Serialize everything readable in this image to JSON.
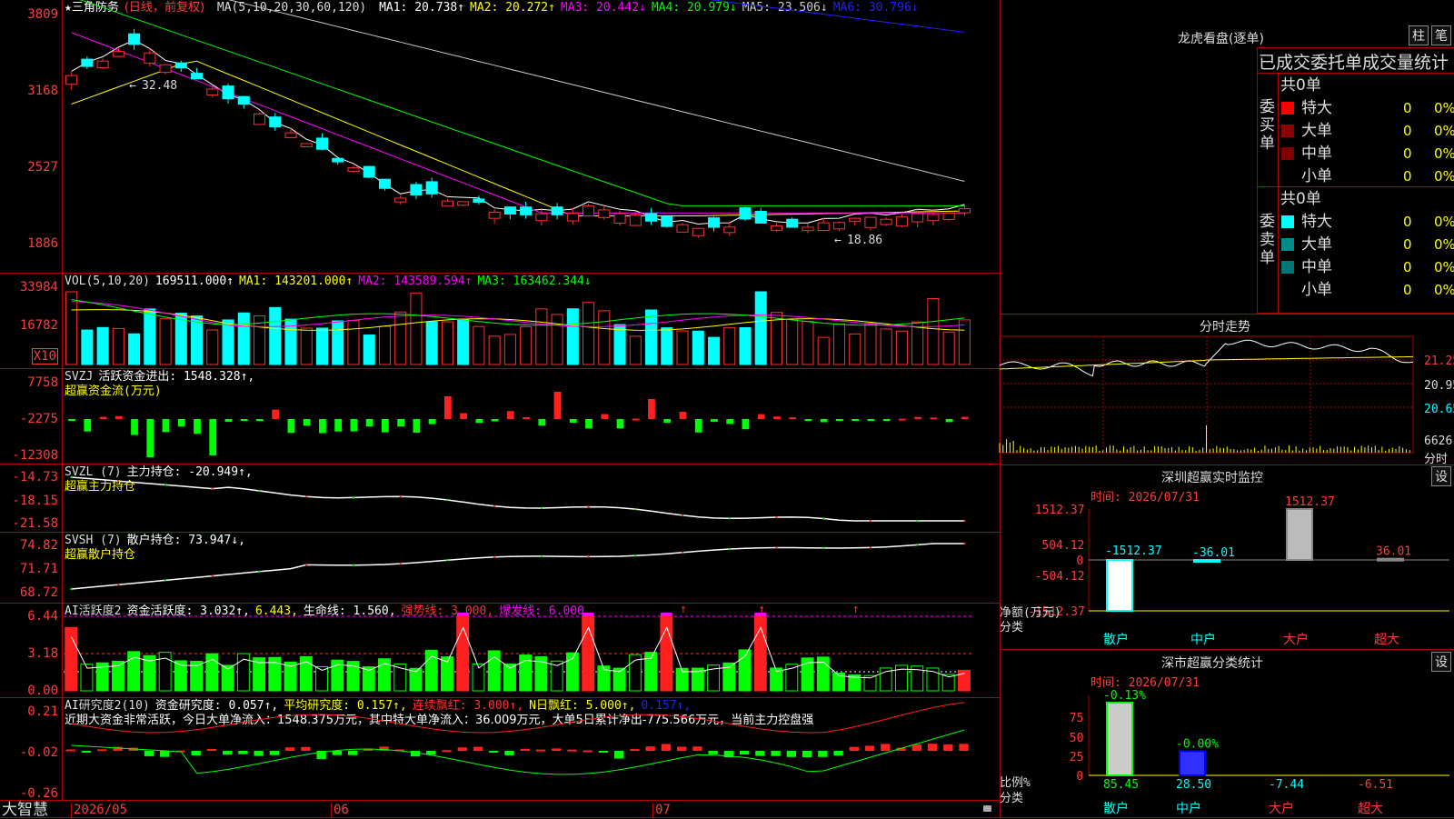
{
  "stock": {
    "name": "三角防务",
    "period": "日线",
    "adjust": "前复权",
    "marker": "★"
  },
  "main": {
    "ma_label": "MA(5,10,20,30,60,120)",
    "ma": [
      {
        "k": "MA1:",
        "v": "20.738↑",
        "color": "#ffffff"
      },
      {
        "k": "MA2:",
        "v": "20.272↑",
        "color": "#ffff00"
      },
      {
        "k": "MA3:",
        "v": "20.442↓",
        "color": "#ff00ff"
      },
      {
        "k": "MA4:",
        "v": "20.979↓",
        "color": "#00ff00"
      },
      {
        "k": "MA5:",
        "v": "23.506↓",
        "color": "#cccccc"
      },
      {
        "k": "MA6:",
        "v": "30.796↓",
        "color": "#2020ff"
      }
    ],
    "y_ticks": [
      "3809",
      "3168",
      "2527",
      "1886"
    ],
    "high_note": "32.48",
    "low_note": "18.86"
  },
  "vol": {
    "label": "VOL(5,10,20)",
    "value": "169511.000↑",
    "ma1": "MA1: 143201.000↑",
    "ma2": "MA2: 143589.594↑",
    "ma3": "MA3: 163462.344↓",
    "y_ticks": [
      "33984",
      "16782"
    ],
    "unit": "X10"
  },
  "svzj": {
    "label": "SVZJ",
    "title": "活跃资金进出: 1548.328↑,",
    "sub": "超赢资金流(万元)",
    "y_ticks": [
      "7758",
      "-2275",
      "-12308"
    ]
  },
  "svzl": {
    "label": "SVZL (7)",
    "title": "主力持仓: -20.949↑,",
    "sub": "超赢主力持仓",
    "y_ticks": [
      "-14.73",
      "-18.15",
      "-21.58"
    ]
  },
  "svsh": {
    "label": "SVSH (7)",
    "title": "散户持仓: 73.947↓,",
    "sub": "超赢散户持仓",
    "y_ticks": [
      "74.82",
      "71.71",
      "68.72"
    ]
  },
  "ai1": {
    "label": "AI活跃度2",
    "t1": "资金活跃度: 3.032↑,",
    "t2": "6.443,",
    "t3": "生命线: 1.560,",
    "t4": "强势线: 3.000,",
    "t5": "爆发线: 6.000,",
    "y_ticks": [
      "6.44",
      "3.18",
      "0.00"
    ]
  },
  "ai2": {
    "label": "AI研究度2(10)",
    "t1": "资金研究度: 0.057↑,",
    "t2": "平均研究度: 0.157↑,",
    "t3": "连续飘红: 3.000↑,",
    "t4": "N日飘红: 5.000↑,",
    "t5": "0.157↑,",
    "note": "近期大资金非常活跃，今日大单净流入：1548.375万元，其中特大单净流入：36.009万元，大单5日累计净出-775.566万元，当前主力控盘强",
    "y_ticks": [
      "0.21",
      "-0.02",
      "-0.26"
    ]
  },
  "footer": {
    "brand": "大智慧",
    "months": [
      "2026/05",
      "06",
      "07"
    ]
  },
  "lhb": {
    "title": "龙虎看盘(逐单)",
    "btn1": "柱",
    "btn2": "笔",
    "header": "已成交委托单成交量统计",
    "buy": {
      "side": "委买单",
      "total": "共0单",
      "rows": [
        {
          "name": "特大",
          "n": "0",
          "p": "0%",
          "color": "#ff0000"
        },
        {
          "name": "大单",
          "n": "0",
          "p": "0%",
          "color": "#8b0000"
        },
        {
          "name": "中单",
          "n": "0",
          "p": "0%",
          "color": "#800000"
        },
        {
          "name": "小单",
          "n": "0",
          "p": "0%",
          "color": ""
        }
      ]
    },
    "sell": {
      "side": "委卖单",
      "total": "共0单",
      "rows": [
        {
          "name": "特大",
          "n": "0",
          "p": "0%",
          "color": "#00ffff"
        },
        {
          "name": "大单",
          "n": "0",
          "p": "0%",
          "color": "#008b8b"
        },
        {
          "name": "中单",
          "n": "0",
          "p": "0%",
          "color": "#007777"
        },
        {
          "name": "小单",
          "n": "0",
          "p": "0%",
          "color": ""
        }
      ]
    }
  },
  "intraday": {
    "title": "分时走势",
    "y_ticks": [
      "21.25",
      "20.95",
      "20.65"
    ],
    "vol_tick": "6626",
    "vol_unit": "分时"
  },
  "monitor": {
    "title": "深圳超赢实时监控",
    "btn": "设",
    "time": "时间: 2026/07/31",
    "y_ticks": [
      "1512.37",
      "504.12",
      "0",
      "-504.12",
      "-1512.37"
    ],
    "ylabel": "净额(万元)",
    "xlabel": "分类",
    "cats": [
      "散户",
      "中户",
      "大户",
      "超大"
    ],
    "values": [
      -1512.37,
      -36.01,
      1512.37,
      36.01
    ],
    "labels": [
      "-1512.37",
      "-36.01",
      "1512.37",
      "36.01"
    ]
  },
  "classify": {
    "title": "深市超赢分类统计",
    "btn": "设",
    "time": "时间: 2026/07/31",
    "y_ticks": [
      "75",
      "50",
      "25",
      "0"
    ],
    "ylabel": "比例%",
    "xlabel": "分类",
    "cats": [
      "散户",
      "中户",
      "大户",
      "超大"
    ],
    "bars": [
      85.45,
      28.5,
      0,
      0
    ],
    "top_labels": [
      "-0.13%",
      "-0.00%",
      "",
      ""
    ],
    "bottom_labels": [
      "85.45",
      "28.50",
      "-7.44",
      "-6.51"
    ]
  }
}
